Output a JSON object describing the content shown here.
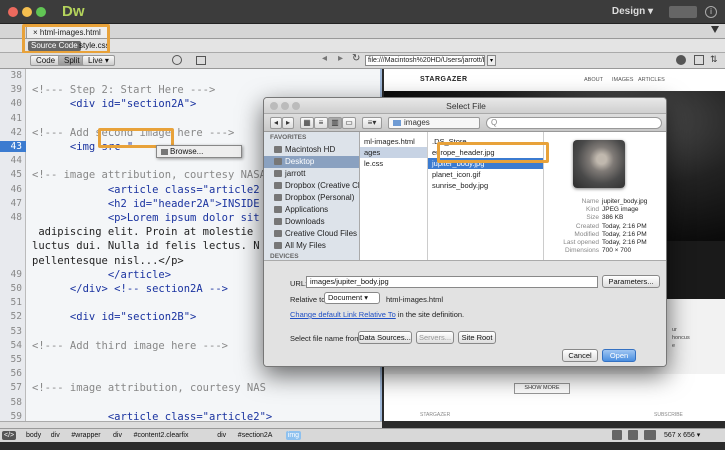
{
  "app": {
    "logo": "Dw",
    "workspace": "Design",
    "workspace_chevron": "▾"
  },
  "document_tab": {
    "close_glyph": "×",
    "name": "html-images.html"
  },
  "related_files": [
    "Source Code",
    "style.css"
  ],
  "view_buttons": [
    "Code",
    "Split",
    "Live"
  ],
  "address_bar": "file:///Macintosh%20HD/Users/jarrott/Dro...",
  "code": {
    "line_numbers": [
      "38",
      "39",
      "40",
      "41",
      "42",
      "43",
      "44",
      "45",
      "46",
      "47",
      "48",
      "",
      "",
      "",
      "49",
      "50",
      "51",
      "52",
      "53",
      "54",
      "55",
      "56",
      "57",
      "58",
      "59",
      "60"
    ],
    "active_line": "43",
    "lines": [
      {
        "cls": "cm",
        "text": ""
      },
      {
        "cls": "cm",
        "text": "<!--- Step 2: Start Here --->"
      },
      {
        "cls": "tg",
        "text": "      <div id=\"section2A\">"
      },
      {
        "cls": "tx",
        "text": ""
      },
      {
        "cls": "cm",
        "text": "<!--- Add second image here --->"
      },
      {
        "cls": "tg",
        "text": "      <img src=\""
      },
      {
        "cls": "tx",
        "text": ""
      },
      {
        "cls": "cm",
        "text": "<!-- image attribution, courtesy NASA"
      },
      {
        "cls": "tg",
        "text": "            <article class=\"article2"
      },
      {
        "cls": "tg",
        "text": "            <h2 id=\"header2A\">INSIDE"
      },
      {
        "cls": "tg",
        "text": "            <p>Lorem ipsum dolor sit"
      },
      {
        "cls": "tx",
        "text": " adipiscing elit. Proin at molestie"
      },
      {
        "cls": "tx",
        "text": "luctus dui. Nulla id felis lectus. N"
      },
      {
        "cls": "tx",
        "text": "pellentesque nisl...</p>"
      },
      {
        "cls": "tg",
        "text": "            </article>"
      },
      {
        "cls": "tg",
        "text": "      </div> <!-- section2A -->"
      },
      {
        "cls": "tx",
        "text": ""
      },
      {
        "cls": "tg",
        "text": "      <div id=\"section2B\">"
      },
      {
        "cls": "tx",
        "text": ""
      },
      {
        "cls": "cm",
        "text": "<!--- Add third image here --->"
      },
      {
        "cls": "tx",
        "text": ""
      },
      {
        "cls": "tx",
        "text": ""
      },
      {
        "cls": "cm",
        "text": "<!--- image attribution, courtesy NAS"
      },
      {
        "cls": "tx",
        "text": ""
      },
      {
        "cls": "tg",
        "text": "            <article class=\"article2\">"
      },
      {
        "cls": "tg",
        "text": "              <h2 id=\"header2B\">NEW HORIZON</h2><p>"
      },
      {
        "cls": "tx",
        "text": "Lorem ipsum dolor sit amet, consectetur adipiscing"
      }
    ],
    "hint_popup": "Browse..."
  },
  "design_view": {
    "site_title": "STARGAZER",
    "nav": [
      "ABOUT",
      "IMAGES",
      "ARTICLES"
    ],
    "show_more": "SHOW MORE",
    "footer_left": "STARGAZER",
    "footer_right": "SUBSCRIBE",
    "snippet_1": "ur",
    "snippet_2": "honcus",
    "snippet_3": "e"
  },
  "status_bar": {
    "tag_selector_label": "</>",
    "crumbs": [
      "body",
      "div",
      "#wrapper",
      "div",
      "#content2.clearfix",
      "div",
      "#section2A",
      "img"
    ],
    "dimensions": "567 x 656"
  },
  "dialog": {
    "title": "Select File",
    "location": "images",
    "search_placeholder": "Q",
    "sidebar": {
      "favorites_heading": "FAVORITES",
      "favorites": [
        "Macintosh HD",
        "Desktop",
        "jarrott",
        "Dropbox (Creative Cl...",
        "Dropbox (Personal)",
        "Applications",
        "Downloads",
        "Creative Cloud Files",
        "All My Files"
      ],
      "devices_heading": "DEVICES"
    },
    "column1": [
      "ml-images.html",
      "ages",
      "le.css"
    ],
    "column2": [
      ".DS_Store",
      "europe_header.jpg",
      "jupiter_body.jpg",
      "planet_icon.gif",
      "sunrise_body.jpg"
    ],
    "selected_file": "jupiter_body.jpg",
    "meta": [
      {
        "k": "Name",
        "v": "jupiter_body.jpg"
      },
      {
        "k": "Kind",
        "v": "JPEG image"
      },
      {
        "k": "Size",
        "v": "386 KB"
      },
      {
        "k": "Created",
        "v": "Today, 2:16 PM"
      },
      {
        "k": "Modified",
        "v": "Today, 2:16 PM"
      },
      {
        "k": "Last opened",
        "v": "Today, 2:16 PM"
      },
      {
        "k": "Dimensions",
        "v": "700 × 700"
      }
    ],
    "url_label": "URL:",
    "url_value": "images/jupiter_body.jpg",
    "parameters_button": "Parameters...",
    "relative_label": "Relative to:",
    "relative_value": "Document",
    "relative_file": "html-images.html",
    "link_text": "Change default Link Relative To",
    "link_suffix": " in the site definition.",
    "select_from_label": "Select file name from:",
    "data_sources_button": "Data Sources...",
    "servers_button": "Servers...",
    "site_root_button": "Site Root",
    "cancel_button": "Cancel",
    "open_button": "Open"
  },
  "colors": {
    "accent_orange": "#e8a23a",
    "selection_blue": "#3b7bd0",
    "dw_green": "#b4d35c"
  }
}
